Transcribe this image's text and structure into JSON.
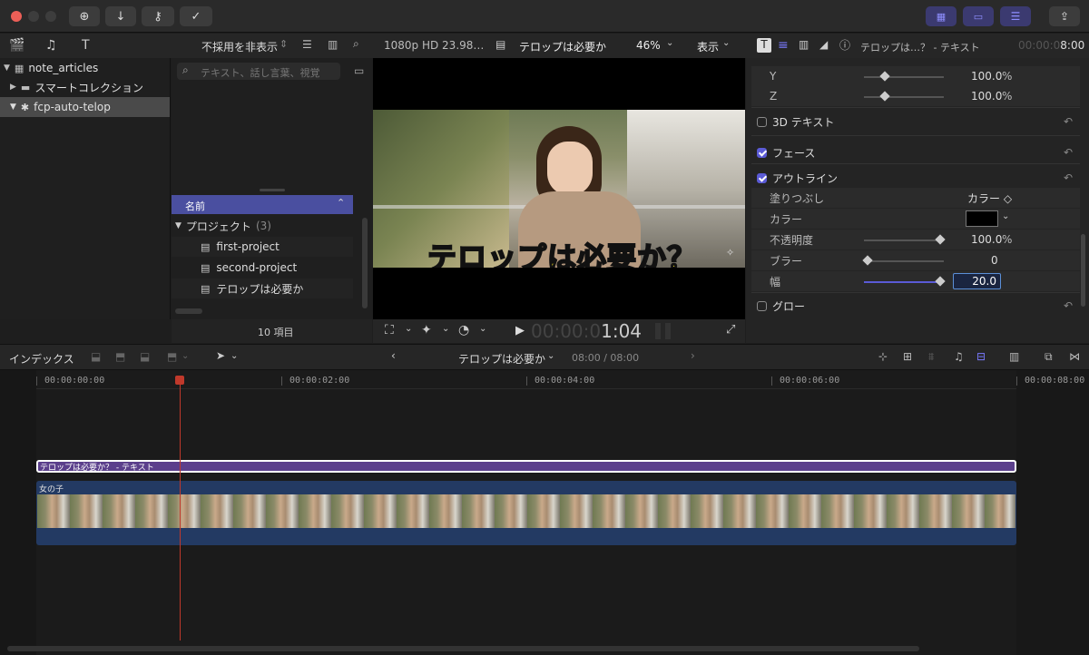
{
  "toolbar": {
    "icons": [
      "import-icon",
      "download-icon",
      "key-icon",
      "check-icon"
    ],
    "right_icons": [
      "browser-grid-icon",
      "timeline-layout-icon",
      "inspector-sliders-icon",
      "share-icon"
    ]
  },
  "library": {
    "items": [
      {
        "label": "note_articles",
        "expanded": true
      },
      {
        "label": "スマートコレクション",
        "expanded": false
      },
      {
        "label": "fcp-auto-telop",
        "expanded": true,
        "selected": true
      }
    ]
  },
  "browser": {
    "filter": "不採用を非表示",
    "search_placeholder": "テキスト、話し言葉、視覚",
    "column_header": "名前",
    "group_label": "プロジェクト",
    "group_count": "(3)",
    "projects": [
      "first-project",
      "second-project",
      "テロップは必要か"
    ],
    "item_count": "10 項目"
  },
  "viewer": {
    "format": "1080p HD 23.98…",
    "project_name": "テロップは必要か",
    "zoom": "46%",
    "view_label": "表示",
    "telop_text": "テロップは必要か？",
    "timecode_dim": "00:00:0",
    "timecode_bright": "1:04"
  },
  "inspector": {
    "title": "テロップは…？ - テキスト",
    "timecode_dim": "00:00:0",
    "timecode_bright": "8:00",
    "rows": {
      "y_label": "Y",
      "y_value": "100.0",
      "y_unit": "%",
      "z_label": "Z",
      "z_value": "100.0",
      "z_unit": "%",
      "text3d_label": "3D テキスト",
      "face_label": "フェース",
      "outline_label": "アウトライン",
      "fill_label": "塗りつぶし",
      "fill_value": "カラー ◇",
      "color_label": "カラー",
      "opacity_label": "不透明度",
      "opacity_value": "100.0",
      "opacity_unit": "%",
      "blur_label": "ブラー",
      "blur_value": "0",
      "width_label": "幅",
      "width_value": "20.0",
      "glow_label": "グロー"
    },
    "slider_levels": {
      "y": 0.24,
      "z": 0.24,
      "opacity": 1.0,
      "blur": 0.0,
      "width": 1.0
    }
  },
  "timeline_bar": {
    "index_label": "インデックス",
    "project_name": "テロップは必要か",
    "duration": "08:00 / 08:00"
  },
  "timeline": {
    "ruler": [
      "00:00:00:00",
      "00:00:02:00",
      "00:00:04:00",
      "00:00:06:00",
      "00:00:08:00"
    ],
    "title_clip": "テロップは必要か？ - テキスト",
    "video_clip": "女の子",
    "playhead_seconds": 1.04
  },
  "colors": {
    "accent": "#5b5bd6",
    "selection": "#4a4fa0",
    "title_clip": "#5b3f8c",
    "video_clip": "#233a63",
    "telop_yellow": "#f5e11e",
    "playhead": "#c0392b"
  }
}
